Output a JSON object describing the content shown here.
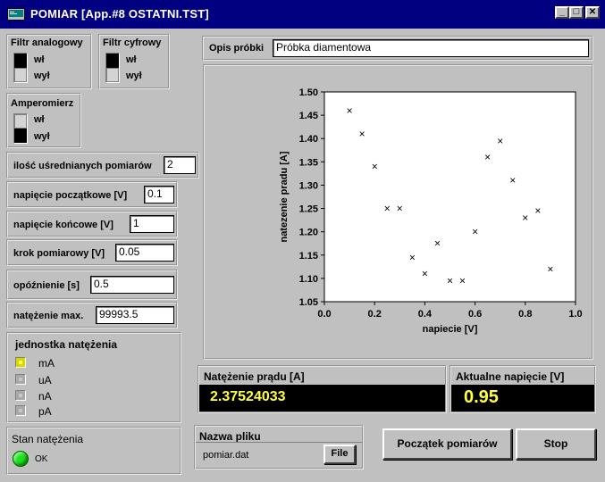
{
  "window": {
    "title": "POMIAR [App.#8 OSTATNI.TST]",
    "min_glyph": "_",
    "max_glyph": "□",
    "close_glyph": "✕"
  },
  "analog_filter": {
    "label": "Filtr analogowy",
    "on": "wł",
    "off": "wył",
    "state": "off"
  },
  "digital_filter": {
    "label": "Filtr cyfrowy",
    "on": "wł",
    "off": "wył",
    "state": "off"
  },
  "ammeter": {
    "label": "Amperomierz",
    "on": "wł",
    "off": "wył",
    "state": "off"
  },
  "fields": {
    "averaged_count": {
      "label": "ilość uśrednianych pomiarów",
      "value": "2"
    },
    "start_voltage": {
      "label": "napięcie początkowe [V]",
      "value": "0.1"
    },
    "end_voltage": {
      "label": "napięcie końcowe [V]",
      "value": "1"
    },
    "step": {
      "label": "krok pomiarowy [V]",
      "value": "0.05"
    },
    "delay": {
      "label": "opóźnienie [s]",
      "value": "0.5"
    },
    "max_current": {
      "label": "natężenie max.",
      "value": "99993.5"
    }
  },
  "current_unit": {
    "label": "jednostka natężenia",
    "options": [
      "mA",
      "uA",
      "nA",
      "pA"
    ],
    "selected": "mA"
  },
  "current_status": {
    "label": "Stan natężenia",
    "value": "OK",
    "color": "#20e020"
  },
  "sample": {
    "label": "Opis próbki",
    "value": "Próbka diamentowa"
  },
  "chart_data": {
    "type": "scatter",
    "xlabel": "napiecie [V]",
    "ylabel": "natezenie pradu [A]",
    "xlim": [
      0.0,
      1.0
    ],
    "ylim": [
      1.05,
      1.5
    ],
    "xticks": [
      "0.0",
      "0.2",
      "0.4",
      "0.6",
      "0.8",
      "1.0"
    ],
    "yticks": [
      "1.05",
      "1.10",
      "1.15",
      "1.20",
      "1.25",
      "1.30",
      "1.35",
      "1.40",
      "1.45",
      "1.50"
    ],
    "marker": "×",
    "x": [
      0.1,
      0.15,
      0.2,
      0.25,
      0.3,
      0.35,
      0.4,
      0.45,
      0.5,
      0.55,
      0.6,
      0.65,
      0.7,
      0.75,
      0.8,
      0.85,
      0.9
    ],
    "y": [
      1.46,
      1.41,
      1.34,
      1.25,
      1.25,
      1.145,
      1.11,
      1.175,
      1.095,
      1.095,
      1.2,
      1.36,
      1.395,
      1.31,
      1.23,
      1.245,
      1.12
    ]
  },
  "current_display": {
    "label": "Natężenie prądu [A]",
    "value": "2.37524033",
    "color": "#ffff40"
  },
  "voltage_display": {
    "label": "Aktualne napięcie [V]",
    "value": "0.95",
    "color": "#ffff40"
  },
  "file": {
    "label": "Nazwa pliku",
    "name": "pomiar.dat",
    "button": "File"
  },
  "buttons": {
    "start": "Początek pomiarów",
    "stop": "Stop"
  }
}
